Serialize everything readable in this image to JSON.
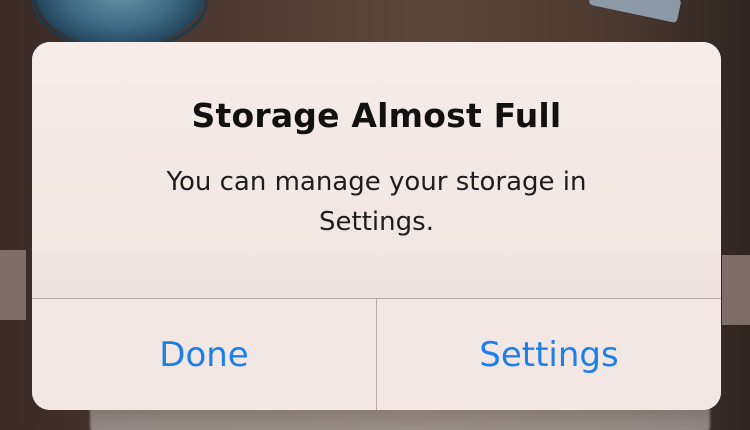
{
  "dialog": {
    "title": "Storage Almost Full",
    "message": "You can manage your storage in Settings.",
    "buttons": {
      "done_label": "Done",
      "settings_label": "Settings"
    }
  },
  "colors": {
    "button_text": "#1d7fe9",
    "dialog_background": "#f3e9e5",
    "separator": "#b8aaa6",
    "title_text": "#111111"
  }
}
